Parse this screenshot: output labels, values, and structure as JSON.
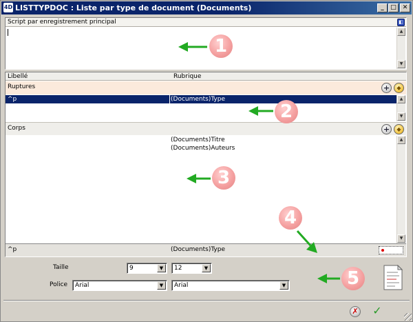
{
  "window": {
    "logo": "4D",
    "title": "LISTTYPDOC : Liste par type de document (Documents)",
    "buttons": {
      "minimize": "_",
      "maximize": "□",
      "close": "✕"
    }
  },
  "script_section": {
    "label": "Script par enregistrement principal",
    "value": ""
  },
  "columns": {
    "libelle": "Libellé",
    "rubrique": "Rubrique"
  },
  "ruptures": {
    "label": "Ruptures",
    "rows": [
      {
        "libelle": "^p",
        "rubrique": "(Documents)Type"
      }
    ]
  },
  "corps": {
    "label": "Corps",
    "rows": [
      {
        "rubrique": "(Documents)Titre"
      },
      {
        "rubrique": "(Documents)Auteurs"
      }
    ]
  },
  "footer_row": {
    "libelle": "^p",
    "rubrique": "(Documents)Type"
  },
  "format": {
    "taille_label": "Taille",
    "taille_1": "9",
    "taille_2": "12",
    "police_label": "Police",
    "police_1": "Arial",
    "police_2": "Arial"
  },
  "callouts": [
    "1",
    "2",
    "3",
    "4",
    "5"
  ],
  "colors": {
    "title_bar": "#0a246a",
    "selected_row": "#0a246a",
    "ruptures_header": "#fbeadc",
    "callout": "#f5a1a1",
    "arrow": "#22aa22"
  },
  "icons": {
    "add": "+",
    "erase": "eraser-icon",
    "cancel": "✗",
    "ok": "✓"
  }
}
